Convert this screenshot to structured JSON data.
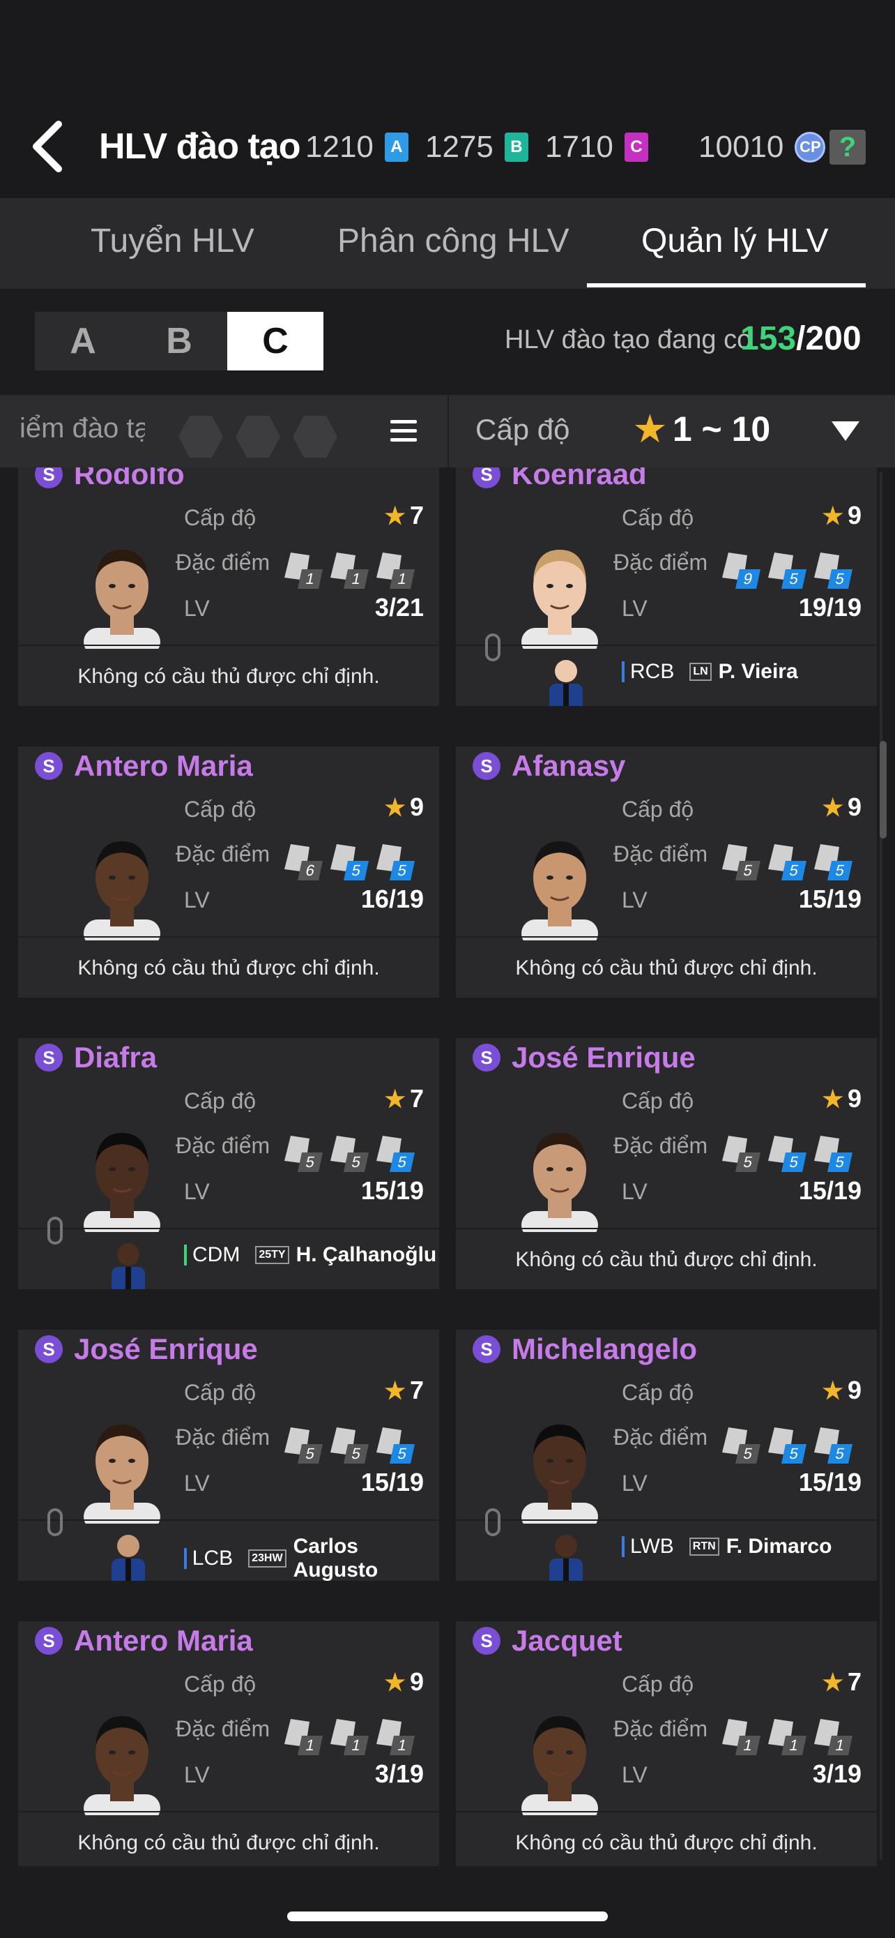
{
  "header": {
    "title": "HLV đào tạo",
    "currencies": [
      {
        "value": "1210",
        "chip": "A",
        "color": "#2f9be6"
      },
      {
        "value": "1275",
        "chip": "B",
        "color": "#1fb59b"
      },
      {
        "value": "1710",
        "chip": "C",
        "color": "#c52fc2"
      }
    ],
    "cp_value": "10010",
    "cp_label": "CP",
    "help": "?"
  },
  "tabs": [
    {
      "label": "Tuyển HLV",
      "active": false
    },
    {
      "label": "Phân công HLV",
      "active": false
    },
    {
      "label": "Quản lý HLV",
      "active": true
    }
  ],
  "grades": [
    "A",
    "B",
    "C"
  ],
  "grade_selected": "C",
  "coach_count": {
    "label": "HLV đào tạo đang có",
    "current": "153",
    "max": "/200"
  },
  "filter": {
    "points_label": "iểm đào tạ",
    "level_label": "Cấp độ",
    "level_range": "1 ~ 10"
  },
  "labels": {
    "level": "Cấp độ",
    "traits": "Đặc điểm",
    "lv": "LV",
    "none_assigned": "Không có cầu thủ được chỉ định."
  },
  "coaches": [
    {
      "name": "Rodolfo",
      "level": "7",
      "lv": "3/21",
      "traits": [
        {
          "n": "1",
          "blue": false
        },
        {
          "n": "1",
          "blue": false
        },
        {
          "n": "1",
          "blue": false
        }
      ],
      "assigned": null,
      "skin": "#c89a78",
      "hair": "#2a1a10"
    },
    {
      "name": "Koenraad",
      "level": "9",
      "lv": "19/19",
      "traits": [
        {
          "n": "9",
          "blue": true
        },
        {
          "n": "5",
          "blue": true
        },
        {
          "n": "5",
          "blue": true
        }
      ],
      "assigned": {
        "pos": "RCB",
        "season": "LN",
        "player": "P. Vieira",
        "bar": "blue"
      },
      "skin": "#efc9ad",
      "hair": "#c9a06a"
    },
    {
      "name": "Antero Maria",
      "level": "9",
      "lv": "16/19",
      "traits": [
        {
          "n": "6",
          "blue": false
        },
        {
          "n": "5",
          "blue": true
        },
        {
          "n": "5",
          "blue": true
        }
      ],
      "assigned": null,
      "skin": "#5a3a26",
      "hair": "#111"
    },
    {
      "name": "Afanasy",
      "level": "9",
      "lv": "15/19",
      "traits": [
        {
          "n": "5",
          "blue": false
        },
        {
          "n": "5",
          "blue": true
        },
        {
          "n": "5",
          "blue": true
        }
      ],
      "assigned": null,
      "skin": "#c9976f",
      "hair": "#141414"
    },
    {
      "name": "Diafra",
      "level": "7",
      "lv": "15/19",
      "traits": [
        {
          "n": "5",
          "blue": false
        },
        {
          "n": "5",
          "blue": false
        },
        {
          "n": "5",
          "blue": true
        }
      ],
      "assigned": {
        "pos": "CDM",
        "season": "25TY",
        "player": "H. Çalhanoğlu",
        "bar": "green"
      },
      "skin": "#4a2e20",
      "hair": "#0c0c0c"
    },
    {
      "name": "José Enrique",
      "level": "9",
      "lv": "15/19",
      "traits": [
        {
          "n": "5",
          "blue": false
        },
        {
          "n": "5",
          "blue": true
        },
        {
          "n": "5",
          "blue": true
        }
      ],
      "assigned": null,
      "skin": "#c89a78",
      "hair": "#2a1a10"
    },
    {
      "name": "José Enrique",
      "level": "7",
      "lv": "15/19",
      "traits": [
        {
          "n": "5",
          "blue": false
        },
        {
          "n": "5",
          "blue": false
        },
        {
          "n": "5",
          "blue": true
        }
      ],
      "assigned": {
        "pos": "LCB",
        "season": "23HW",
        "player": "Carlos Augusto",
        "bar": "blue"
      },
      "skin": "#c89a78",
      "hair": "#2a1a10"
    },
    {
      "name": "Michelangelo",
      "level": "9",
      "lv": "15/19",
      "traits": [
        {
          "n": "5",
          "blue": false
        },
        {
          "n": "5",
          "blue": true
        },
        {
          "n": "5",
          "blue": true
        }
      ],
      "assigned": {
        "pos": "LWB",
        "season": "RTN",
        "player": "F. Dimarco",
        "bar": "blue"
      },
      "skin": "#4a2e20",
      "hair": "#0c0c0c"
    },
    {
      "name": "Antero Maria",
      "level": "9",
      "lv": "3/19",
      "traits": [
        {
          "n": "1",
          "blue": false
        },
        {
          "n": "1",
          "blue": false
        },
        {
          "n": "1",
          "blue": false
        }
      ],
      "assigned": null,
      "skin": "#5a3a26",
      "hair": "#111"
    },
    {
      "name": "Jacquet",
      "level": "7",
      "lv": "3/19",
      "traits": [
        {
          "n": "1",
          "blue": false
        },
        {
          "n": "1",
          "blue": false
        },
        {
          "n": "1",
          "blue": false
        }
      ],
      "assigned": null,
      "skin": "#5a3a26",
      "hair": "#111"
    }
  ]
}
